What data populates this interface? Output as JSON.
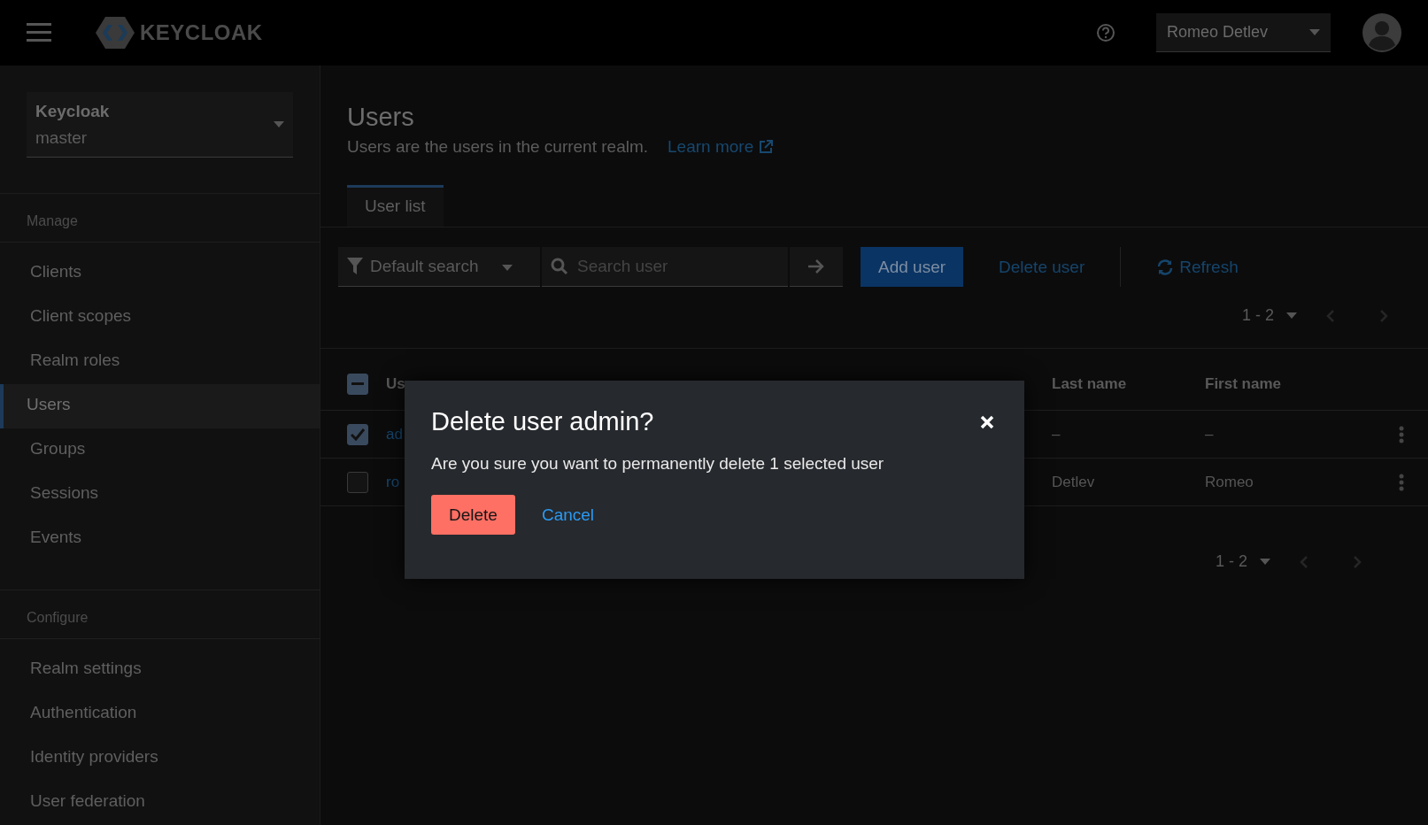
{
  "masthead": {
    "logo_text": "KEYCLOAK",
    "user_menu": "Romeo Detlev"
  },
  "sidebar": {
    "realm": {
      "name": "Keycloak",
      "value": "master"
    },
    "sections": [
      {
        "title": "Manage",
        "items": [
          {
            "label": "Clients",
            "selected": false
          },
          {
            "label": "Client scopes",
            "selected": false
          },
          {
            "label": "Realm roles",
            "selected": false
          },
          {
            "label": "Users",
            "selected": true
          },
          {
            "label": "Groups",
            "selected": false
          },
          {
            "label": "Sessions",
            "selected": false
          },
          {
            "label": "Events",
            "selected": false
          }
        ]
      },
      {
        "title": "Configure",
        "items": [
          {
            "label": "Realm settings",
            "selected": false
          },
          {
            "label": "Authentication",
            "selected": false
          },
          {
            "label": "Identity providers",
            "selected": false
          },
          {
            "label": "User federation",
            "selected": false
          }
        ]
      }
    ]
  },
  "page": {
    "title": "Users",
    "description": "Users are the users in the current realm.",
    "link": "Learn more"
  },
  "tabs": [
    {
      "label": "User list",
      "selected": true
    }
  ],
  "toolbar": {
    "search_type": "Default search",
    "search": {
      "placeholder": "Search user"
    },
    "buttons": [
      {
        "label": "Add user",
        "kind": "primary"
      },
      {
        "label": "Delete user",
        "kind": "link"
      },
      {
        "label": "Refresh",
        "kind": "refresh"
      }
    ]
  },
  "pagination_top": "1 - 2",
  "table": {
    "select_all": {
      "indeterminate": true
    },
    "columns": [
      "Us",
      "Last name",
      "First name"
    ],
    "rows": [
      {
        "selected": true,
        "cells": [
          "ad",
          "–",
          "–"
        ]
      },
      {
        "selected": false,
        "cells": [
          "ro",
          "Detlev",
          "Romeo"
        ]
      }
    ]
  },
  "pagination_bottom": "1 - 2",
  "modal": {
    "title": "Delete user admin?",
    "body": "Are you sure you want to permanently delete 1 selected user",
    "buttons": [
      {
        "label": "Delete",
        "kind": "danger"
      },
      {
        "label": "Cancel",
        "kind": "link"
      }
    ]
  }
}
